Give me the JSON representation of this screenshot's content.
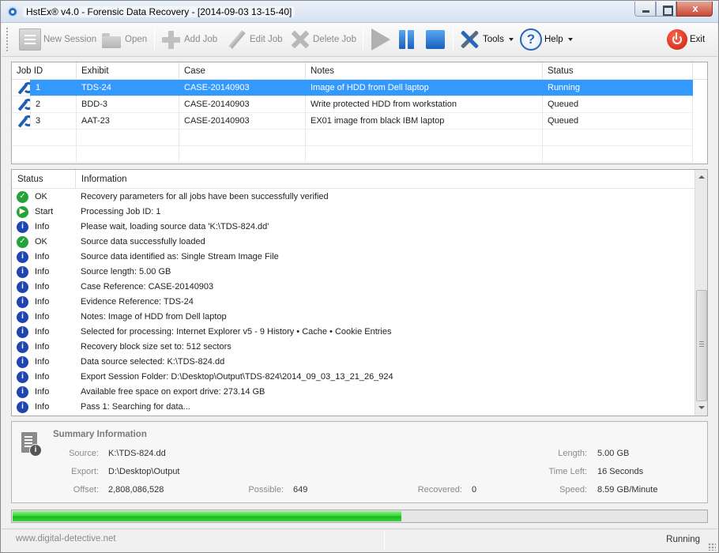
{
  "window": {
    "title": "HstEx® v4.0 - Forensic Data Recovery - [2014-09-03 13-15-40]",
    "close_glyph": "x"
  },
  "toolbar": {
    "new_session": "New Session",
    "open": "Open",
    "add_job": "Add Job",
    "edit_job": "Edit Job",
    "delete_job": "Delete Job",
    "tools": "Tools",
    "help": "Help",
    "help_glyph": "?",
    "exit": "Exit"
  },
  "jobs": {
    "columns": [
      "Job ID",
      "Exhibit",
      "Case",
      "Notes",
      "Status"
    ],
    "rows": [
      {
        "id": "1",
        "exhibit": "TDS-24",
        "case": "CASE-20140903",
        "notes": "Image of HDD from Dell laptop",
        "status": "Running",
        "selected": true
      },
      {
        "id": "2",
        "exhibit": "BDD-3",
        "case": "CASE-20140903",
        "notes": "Write protected HDD from workstation",
        "status": "Queued"
      },
      {
        "id": "3",
        "exhibit": "AAT-23",
        "case": "CASE-20140903",
        "notes": "EX01 image from black IBM laptop",
        "status": "Queued"
      }
    ]
  },
  "log": {
    "columns": [
      "Status",
      "Information"
    ],
    "rows": [
      {
        "type": "ok",
        "status": "OK",
        "text": "Recovery parameters for all jobs have been successfully verified"
      },
      {
        "type": "start",
        "status": "Start",
        "text": "Processing Job ID: 1"
      },
      {
        "type": "info",
        "status": "Info",
        "text": "Please wait, loading source data 'K:\\TDS-824.dd'"
      },
      {
        "type": "ok",
        "status": "OK",
        "text": "Source data successfully loaded"
      },
      {
        "type": "info",
        "status": "Info",
        "text": "Source data identified as: Single Stream Image File"
      },
      {
        "type": "info",
        "status": "Info",
        "text": "Source length: 5.00 GB"
      },
      {
        "type": "info",
        "status": "Info",
        "text": "Case Reference: CASE-20140903"
      },
      {
        "type": "info",
        "status": "Info",
        "text": "Evidence Reference: TDS-24"
      },
      {
        "type": "info",
        "status": "Info",
        "text": "Notes: Image of HDD from Dell laptop"
      },
      {
        "type": "info",
        "status": "Info",
        "text": "Selected for processing: Internet Explorer v5 - 9 History • Cache • Cookie Entries"
      },
      {
        "type": "info",
        "status": "Info",
        "text": "Recovery block size set to: 512 sectors"
      },
      {
        "type": "info",
        "status": "Info",
        "text": "Data source selected: K:\\TDS-824.dd"
      },
      {
        "type": "info",
        "status": "Info",
        "text": "Export Session Folder: D:\\Desktop\\Output\\TDS-824\\2014_09_03_13_21_26_924"
      },
      {
        "type": "info",
        "status": "Info",
        "text": "Available free space on export drive: 273.14 GB"
      },
      {
        "type": "info",
        "status": "Info",
        "text": "Pass 1: Searching for data..."
      }
    ]
  },
  "summary": {
    "title": "Summary Information",
    "source_label": "Source:",
    "source": "K:\\TDS-824.dd",
    "export_label": "Export:",
    "export": "D:\\Desktop\\Output",
    "offset_label": "Offset:",
    "offset": "2,808,086,528",
    "possible_label": "Possible:",
    "possible": "649",
    "recovered_label": "Recovered:",
    "recovered": "0",
    "length_label": "Length:",
    "length": "5.00 GB",
    "timeleft_label": "Time Left:",
    "timeleft": "16 Seconds",
    "speed_label": "Speed:",
    "speed": "8.59 GB/Minute"
  },
  "progress": {
    "fraction": 0.56
  },
  "statusbar": {
    "left": "www.digital-detective.net",
    "right": "Running"
  },
  "colors": {
    "selection": "#3399ff",
    "ok": "#25a33a",
    "info": "#1f45b0",
    "progress": "#1db81d"
  }
}
